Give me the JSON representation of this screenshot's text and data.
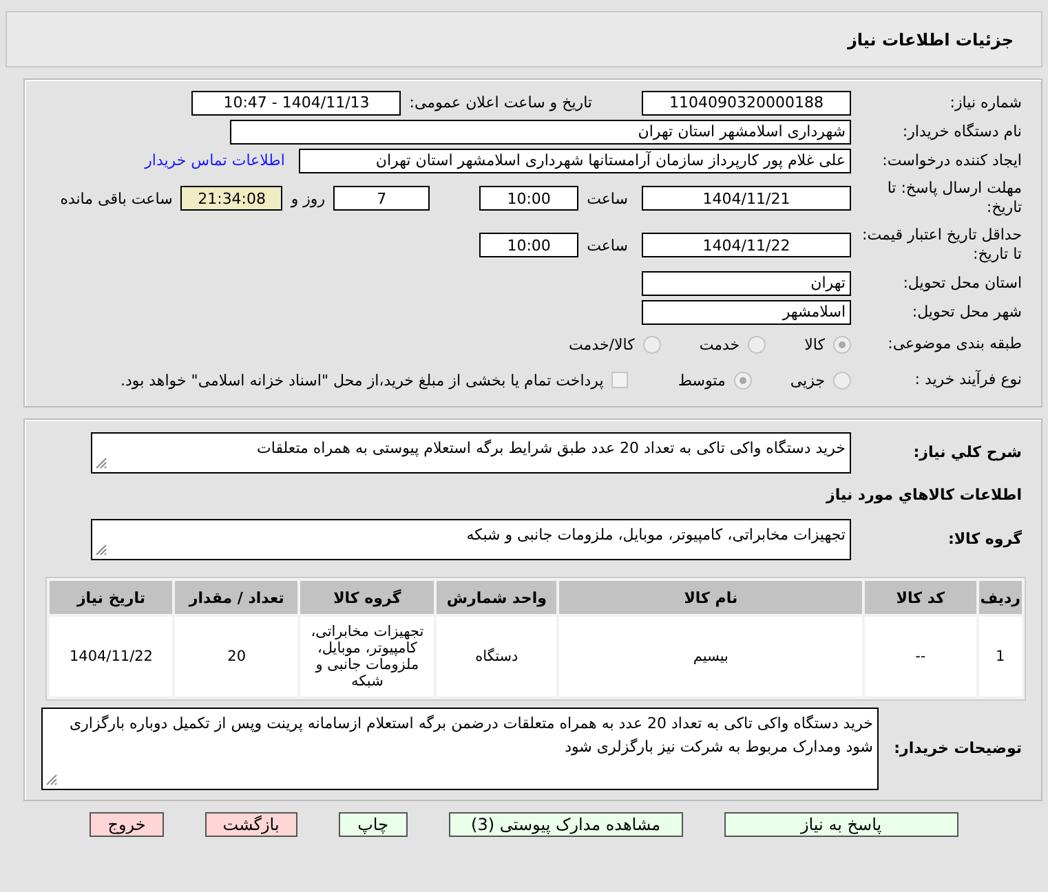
{
  "header": {
    "title": "جزئیات اطلاعات نیاز"
  },
  "need_number": {
    "label": "شماره نیاز:",
    "value": "1104090320000188"
  },
  "announce_datetime": {
    "label": "تاریخ و ساعت اعلان عمومی:",
    "value": "1404/11/13 - 10:47"
  },
  "buyer_org": {
    "label": "نام دستگاه خریدار:",
    "value": "شهرداری اسلامشهر استان تهران"
  },
  "requester": {
    "label": "ایجاد کننده درخواست:",
    "value": "علی غلام پور کارپرداز سازمان آرامستانها شهرداری اسلامشهر استان تهران",
    "contact_link": "اطلاعات تماس خریدار"
  },
  "response_deadline": {
    "label": "مهلت ارسال پاسخ: تا تاریخ:",
    "date": "1404/11/21",
    "time_label": "ساعت",
    "time": "10:00",
    "days": "7",
    "days_label": "روز و",
    "remaining": "21:34:08",
    "remaining_label": "ساعت باقی مانده"
  },
  "price_validity": {
    "label": "حداقل تاریخ اعتبار قیمت: تا تاریخ:",
    "date": "1404/11/22",
    "time_label": "ساعت",
    "time": "10:00"
  },
  "province": {
    "label": "استان محل تحویل:",
    "value": "تهران"
  },
  "city": {
    "label": "شهر محل تحویل:",
    "value": "اسلامشهر"
  },
  "category": {
    "label": "طبقه بندی موضوعی:",
    "options": [
      {
        "label": "کالا",
        "selected": true
      },
      {
        "label": "خدمت",
        "selected": false
      },
      {
        "label": "کالا/خدمت",
        "selected": false
      }
    ]
  },
  "purchase_process": {
    "label": "نوع فرآیند خرید :",
    "options": [
      {
        "label": "جزیی",
        "selected": false
      },
      {
        "label": "متوسط",
        "selected": true
      }
    ],
    "treasury": {
      "checked": false,
      "label": "پرداخت تمام یا بخشی از مبلغ خرید،از محل \"اسناد خزانه اسلامی\" خواهد بود."
    }
  },
  "description": {
    "label": "شرح کلي نياز:",
    "value": "خرید دستگاه واکی تاکی به تعداد 20 عدد طبق شرایط برگه استعلام پیوستی به همراه متعلقات"
  },
  "goods_heading": "اطلاعات کالاهاي مورد نياز",
  "goods_group": {
    "label": "گروه کالا:",
    "value": "تجهیزات مخابراتی، کامپیوتر، موبایل، ملزومات جانبی و شبکه"
  },
  "table": {
    "columns": [
      "ردیف",
      "کد کالا",
      "نام کالا",
      "واحد شمارش",
      "گروه کالا",
      "تعداد / مقدار",
      "تاریخ نیاز"
    ],
    "rows": [
      [
        "1",
        "--",
        "بیسیم",
        "دستگاه",
        "تجهیزات مخابراتی، کامپیوتر، موبایل، ملزومات جانبی و شبکه",
        "20",
        "1404/11/22"
      ]
    ]
  },
  "buyer_notes": {
    "label": "توضیحات خریدار:",
    "value": "خرید دستگاه واکی تاکی به تعداد 20 عدد به همراه متعلقات درضمن برگه استعلام ازسامانه پرینت وپس از تکمیل دوباره بارگزاری شود ومدارک مربوط به شرکت نیز بارگزلری شود"
  },
  "buttons": [
    {
      "label": "پاسخ به نیاز",
      "kind": "action"
    },
    {
      "label": "مشاهده مدارک پیوستی (3)",
      "kind": "action"
    },
    {
      "label": "چاپ",
      "kind": "action"
    },
    {
      "label": "بازگشت",
      "kind": "exit"
    },
    {
      "label": "خروج",
      "kind": "exit"
    }
  ]
}
